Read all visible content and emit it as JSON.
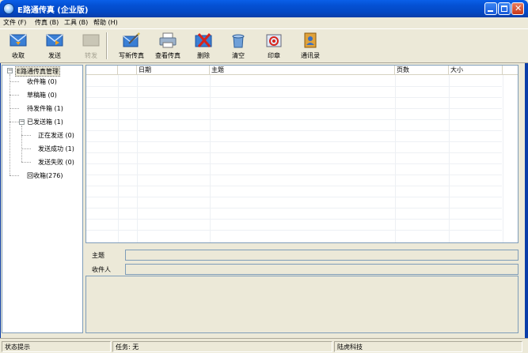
{
  "window": {
    "title": "E路通传真 (企业版)"
  },
  "menu": [
    "文件 (F)",
    "传真 (B)",
    "工具 (B)",
    "帮助 (H)"
  ],
  "toolbar": {
    "receive": "收取",
    "send": "发送",
    "forward": "转发",
    "compose": "写新传真",
    "view": "查看传真",
    "delete": "删除",
    "clear": "清空",
    "stamp": "印章",
    "contacts": "通讯录"
  },
  "tree": {
    "root": "E路通传真管理",
    "inbox": "收件箱 (0)",
    "drafts": "草稿箱 (0)",
    "outbox": "待发件箱 (1)",
    "sent": "已发送箱 (1)",
    "sending": "正在发送 (0)",
    "sent_ok": "发送成功 (1)",
    "sent_fail": "发送失败 (0)",
    "recycle": "回收箱(276)"
  },
  "list": {
    "columns": [
      "",
      "",
      "日期",
      "主题",
      "页数",
      "大小"
    ]
  },
  "detail": {
    "subject_label": "主题",
    "recipient_label": "收件人"
  },
  "status": {
    "hint": "状态提示",
    "task": "任务: 无",
    "company": "陆虎科技"
  }
}
